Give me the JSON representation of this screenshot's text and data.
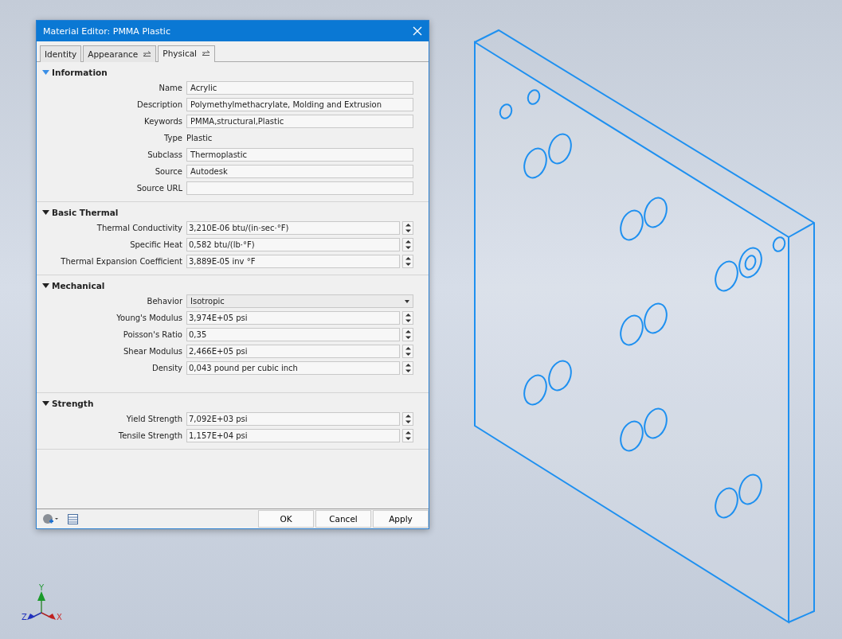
{
  "window": {
    "title": "Material Editor: PMMA Plastic"
  },
  "tabs": [
    {
      "label": "Identity",
      "selected": false,
      "linked": false
    },
    {
      "label": "Appearance",
      "selected": false,
      "linked": true
    },
    {
      "label": "Physical",
      "selected": true,
      "linked": true
    }
  ],
  "sections": [
    {
      "title": "Information",
      "expanded": true,
      "highlighted": true,
      "rows": [
        {
          "kind": "text",
          "label": "Name",
          "value": "Acrylic"
        },
        {
          "kind": "text",
          "label": "Description",
          "value": "Polymethylmethacrylate, Molding and Extrusion"
        },
        {
          "kind": "text",
          "label": "Keywords",
          "value": "PMMA,structural,Plastic"
        },
        {
          "kind": "static",
          "label": "Type",
          "value": "Plastic"
        },
        {
          "kind": "text",
          "label": "Subclass",
          "value": "Thermoplastic"
        },
        {
          "kind": "text",
          "label": "Source",
          "value": "Autodesk"
        },
        {
          "kind": "text",
          "label": "Source URL"
        }
      ]
    },
    {
      "title": "Basic Thermal",
      "expanded": true,
      "highlighted": false,
      "rows": [
        {
          "kind": "spinner",
          "label": "Thermal Conductivity",
          "value": "3,210E-06 btu/(in·sec·°F)"
        },
        {
          "kind": "spinner",
          "label": "Specific Heat",
          "value": "0,582 btu/(lb·°F)"
        },
        {
          "kind": "spinner",
          "label": "Thermal Expansion Coefficient",
          "value": "3,889E-05 inv °F"
        }
      ]
    },
    {
      "title": "Mechanical",
      "expanded": true,
      "highlighted": false,
      "rows": [
        {
          "kind": "dropdown",
          "label": "Behavior",
          "value": "Isotropic"
        },
        {
          "kind": "spinner",
          "label": "Young's Modulus",
          "value": "3,974E+05 psi"
        },
        {
          "kind": "spinner",
          "label": "Poisson's Ratio",
          "value": "0,35"
        },
        {
          "kind": "spinner",
          "label": "Shear Modulus",
          "value": "2,466E+05 psi"
        },
        {
          "kind": "spinner",
          "label": "Density",
          "value": "0,043 pound per cubic inch"
        }
      ]
    },
    {
      "title": "Strength",
      "expanded": true,
      "highlighted": false,
      "rows": [
        {
          "kind": "spinner",
          "label": "Yield Strength",
          "value": "7,092E+03 psi"
        },
        {
          "kind": "spinner",
          "label": "Tensile Strength",
          "value": "1,157E+04 psi"
        }
      ]
    }
  ],
  "buttons": [
    "OK",
    "Cancel",
    "Apply"
  ],
  "triad": {
    "x": "X",
    "y": "Y",
    "z": "Z"
  }
}
